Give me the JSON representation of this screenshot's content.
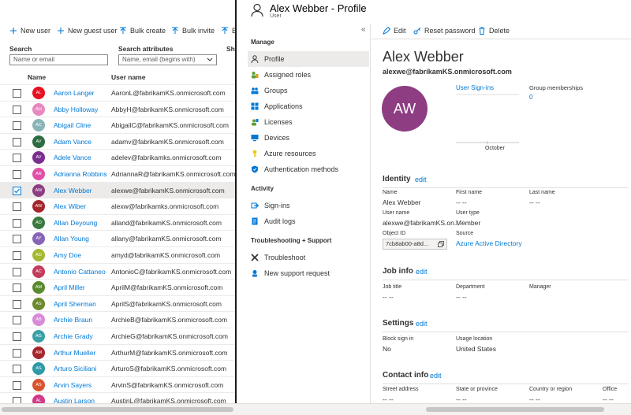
{
  "toolbar": {
    "new_user": "New user",
    "new_guest_user": "New guest user",
    "bulk_create": "Bulk create",
    "bulk_invite": "Bulk invite",
    "bulk_truncated": "B"
  },
  "filters": {
    "search_label": "Search",
    "search_placeholder": "Name or email",
    "attributes_label": "Search attributes",
    "attributes_value": "Name, email (begins with)",
    "show_label_truncated": "Sh"
  },
  "list": {
    "col_name": "Name",
    "col_username": "User name",
    "rows": [
      {
        "initials": "AL",
        "name": "Aaron Langer",
        "username": "AaronL@fabrikamKS.onmicrosoft.com",
        "color": "#e81123",
        "selected": false
      },
      {
        "initials": "AH",
        "name": "Abby Holloway",
        "username": "AbbyH@fabrikamKS.onmicrosoft.com",
        "color": "#e987c0",
        "selected": false
      },
      {
        "initials": "AC",
        "name": "Abigail Cline",
        "username": "AbigailC@fabrikamKS.onmicrosoft.com",
        "color": "#8ab4b8",
        "selected": false
      },
      {
        "initials": "AV",
        "name": "Adam Vance",
        "username": "adamv@fabrikamKS.onmicrosoft.com",
        "color": "#2d6b42",
        "selected": false
      },
      {
        "initials": "AV",
        "name": "Adele Vance",
        "username": "adelev@fabrikamks.onmicrosoft.com",
        "color": "#7a2e8f",
        "selected": false
      },
      {
        "initials": "AR",
        "name": "Adrianna Robbins",
        "username": "AdriannaR@fabrikamKS.onmicrosoft.com",
        "color": "#e34fa8",
        "selected": false
      },
      {
        "initials": "AW",
        "name": "Alex Webber",
        "username": "alexwe@fabrikamKS.onmicrosoft.com",
        "color": "#8e3d82",
        "selected": true
      },
      {
        "initials": "AW",
        "name": "Alex Wiber",
        "username": "alexw@fabrikamks.onmicrosoft.com",
        "color": "#a4262c",
        "selected": false
      },
      {
        "initials": "AD",
        "name": "Allan Deyoung",
        "username": "alland@fabrikamKS.onmicrosoft.com",
        "color": "#3a7a3e",
        "selected": false
      },
      {
        "initials": "AY",
        "name": "Allan Young",
        "username": "allany@fabrikamKS.onmicrosoft.com",
        "color": "#8764b8",
        "selected": false
      },
      {
        "initials": "AD",
        "name": "Amy Doe",
        "username": "amyd@fabrikamKS.onmicrosoft.com",
        "color": "#a6b830",
        "selected": false
      },
      {
        "initials": "AC",
        "name": "Antonio Cattaneo",
        "username": "AntonioC@fabrikamKS.onmicrosoft.com",
        "color": "#c43c5c",
        "selected": false
      },
      {
        "initials": "AM",
        "name": "April Miller",
        "username": "AprilM@fabrikamKS.onmicrosoft.com",
        "color": "#5a8a2e",
        "selected": false
      },
      {
        "initials": "AS",
        "name": "April Sherman",
        "username": "AprilS@fabrikamKS.onmicrosoft.com",
        "color": "#6b8a2e",
        "selected": false
      },
      {
        "initials": "AB",
        "name": "Archie Braun",
        "username": "ArchieB@fabrikamKS.onmicrosoft.com",
        "color": "#d98ad8",
        "selected": false
      },
      {
        "initials": "AG",
        "name": "Archie Grady",
        "username": "ArchieG@fabrikamKS.onmicrosoft.com",
        "color": "#3aa0a8",
        "selected": false
      },
      {
        "initials": "AM",
        "name": "Arthur Mueller",
        "username": "ArthurM@fabrikamKS.onmicrosoft.com",
        "color": "#a4262c",
        "selected": false
      },
      {
        "initials": "AS",
        "name": "Arturo Siciliani",
        "username": "ArturoS@fabrikamKS.onmicrosoft.com",
        "color": "#2e9aa8",
        "selected": false
      },
      {
        "initials": "AS",
        "name": "Arvin Sayers",
        "username": "ArvinS@fabrikamKS.onmicrosoft.com",
        "color": "#d9542e",
        "selected": false
      },
      {
        "initials": "AL",
        "name": "Austin Larson",
        "username": "AustinL@fabrikamKS.onmicrosoft.com",
        "color": "#d13a8a",
        "selected": false
      }
    ]
  },
  "blade": {
    "title": "Alex Webber - Profile",
    "subtitle": "User",
    "collapse_glyph": "«"
  },
  "menu": {
    "manage_title": "Manage",
    "items_manage": [
      {
        "label": "Profile",
        "icon": "person-icon"
      },
      {
        "label": "Assigned roles",
        "icon": "roles-icon"
      },
      {
        "label": "Groups",
        "icon": "groups-icon"
      },
      {
        "label": "Applications",
        "icon": "applications-icon"
      },
      {
        "label": "Licenses",
        "icon": "licenses-icon"
      },
      {
        "label": "Devices",
        "icon": "devices-icon"
      },
      {
        "label": "Azure resources",
        "icon": "key-icon"
      },
      {
        "label": "Authentication methods",
        "icon": "shield-icon"
      }
    ],
    "activity_title": "Activity",
    "items_activity": [
      {
        "label": "Sign-ins",
        "icon": "signins-icon"
      },
      {
        "label": "Audit logs",
        "icon": "audit-logs-icon"
      }
    ],
    "troubleshoot_title": "Troubleshooting + Support",
    "items_troubleshoot": [
      {
        "label": "Troubleshoot",
        "icon": "wrench-icon"
      },
      {
        "label": "New support request",
        "icon": "support-icon"
      }
    ]
  },
  "commands": {
    "edit": "Edit",
    "reset_password": "Reset password",
    "delete": "Delete"
  },
  "profile": {
    "display_name": "Alex Webber",
    "upn": "alexwe@fabrikamKS.onmicrosoft.com",
    "avatar_initials": "AW",
    "avatar_color": "#8e3d82",
    "signins_link": "User Sign-ins",
    "signins_month": "October",
    "group_memberships_label": "Group memberships",
    "group_memberships_value": "0"
  },
  "identity": {
    "title": "Identity",
    "edit": "edit",
    "name_label": "Name",
    "name_value": "Alex Webber",
    "first_name_label": "First name",
    "first_name_value": "-- --",
    "last_name_label": "Last name",
    "last_name_value": "-- --",
    "user_name_label": "User name",
    "user_name_value": "alexwe@fabrikamKS.on...",
    "user_type_label": "User type",
    "user_type_value": "Member",
    "object_id_label": "Object ID",
    "object_id_value": "7cb8ab00-a8d...",
    "source_label": "Source",
    "source_value": "Azure Active Directory"
  },
  "job_info": {
    "title": "Job info",
    "edit": "edit",
    "job_title_label": "Job title",
    "job_title_value": "-- --",
    "department_label": "Department",
    "department_value": "-- --",
    "manager_label": "Manager"
  },
  "settings": {
    "title": "Settings",
    "edit": "edit",
    "block_sign_in_label": "Block sign in",
    "block_sign_in_value": "No",
    "usage_location_label": "Usage location",
    "usage_location_value": "United States"
  },
  "contact_info": {
    "title": "Contact info",
    "edit": "edit",
    "street_label": "Street address",
    "street_value": "-- --",
    "state_label": "State or province",
    "state_value": "-- --",
    "country_label": "Country or region",
    "country_value": "-- --",
    "office_label": "Office",
    "office_value": "-- --"
  }
}
